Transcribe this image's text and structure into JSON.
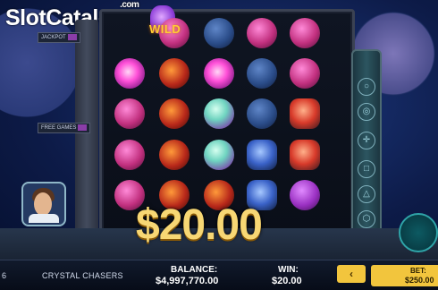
{
  "watermark": {
    "slot": "Slot",
    "catalog": "Catalog",
    "com": ".com"
  },
  "left_tags": {
    "jackpot": "JACKPOT",
    "free_games": "FREE GAMES"
  },
  "reels": {
    "wild_label": "WILD"
  },
  "symbols": [
    [
      "wild-crystal",
      "pink-planet",
      "blue-asteroid",
      "pink-planet",
      "pink-planet"
    ],
    [
      "glowing-pink-orb",
      "red-cracked-orb",
      "glowing-pink-orb",
      "blue-asteroid",
      "pink-planet"
    ],
    [
      "pink-planet",
      "red-cracked-orb",
      "crystal-gem",
      "blue-asteroid",
      "red-rocket"
    ],
    [
      "pink-planet",
      "red-cracked-orb",
      "crystal-gem",
      "blue-spaceship",
      "red-rocket"
    ],
    [
      "pink-planet",
      "red-cracked-orb",
      "red-cracked-orb",
      "blue-spaceship",
      "purple-planet"
    ]
  ],
  "win_display": "$20.00",
  "bottom": {
    "left_number": "6",
    "game_title": "CRYSTAL CHASERS",
    "balance_label": "BALANCE:",
    "balance_value": "$4,997,770.00",
    "win_label": "WIN:",
    "win_value": "$20.00",
    "arrow": "‹",
    "bet_label": "BET:",
    "bet_value": "$250.00"
  },
  "colors": {
    "accent_gold": "#f2c53d",
    "win_text": "#f7d774",
    "panel_teal": "#2c5560"
  }
}
